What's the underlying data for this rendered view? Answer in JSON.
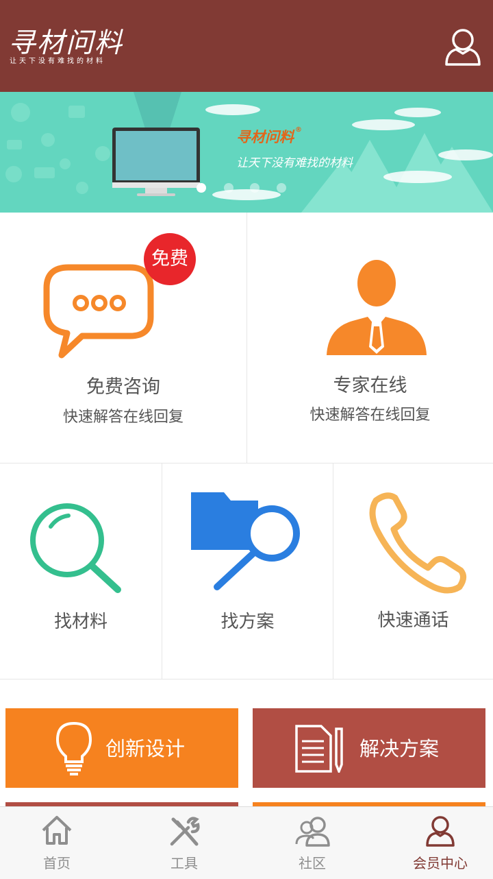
{
  "header": {
    "logo_title": "寻材问料",
    "logo_subtitle": "让天下没有难找的材料",
    "user_icon": "user-icon"
  },
  "banner": {
    "brand": "寻材问料",
    "registered_mark": "®",
    "slogan": "让天下没有难找的材料",
    "slides_total": 4,
    "active_slide": 1
  },
  "services_top": [
    {
      "title": "免费咨询",
      "subtitle": "快速解答在线回复",
      "badge": "免费",
      "icon": "chat-bubble-icon"
    },
    {
      "title": "专家在线",
      "subtitle": "快速解答在线回复",
      "icon": "expert-person-icon"
    }
  ],
  "services_mid": [
    {
      "label": "找材料",
      "icon": "magnifier-icon"
    },
    {
      "label": "找方案",
      "icon": "folder-search-icon"
    },
    {
      "label": "快速通话",
      "icon": "phone-icon"
    }
  ],
  "actions": [
    {
      "label": "创新设计",
      "icon": "lightbulb-icon",
      "color": "#f6821f"
    },
    {
      "label": "解决方案",
      "icon": "document-pen-icon",
      "color": "#b14e44"
    }
  ],
  "tabbar": [
    {
      "label": "首页",
      "icon": "home-icon",
      "active": false
    },
    {
      "label": "工具",
      "icon": "tools-icon",
      "active": false
    },
    {
      "label": "社区",
      "icon": "community-icon",
      "active": false
    },
    {
      "label": "会员中心",
      "icon": "member-icon",
      "active": true
    }
  ],
  "colors": {
    "header_bg": "#813a34",
    "banner_bg": "#63d6bf",
    "accent_orange": "#f6821f",
    "accent_red": "#b14e44",
    "badge_red": "#e8262b",
    "search_green": "#34bf8e",
    "folder_blue": "#2a7ee0",
    "phone_yellow": "#f6b456"
  }
}
